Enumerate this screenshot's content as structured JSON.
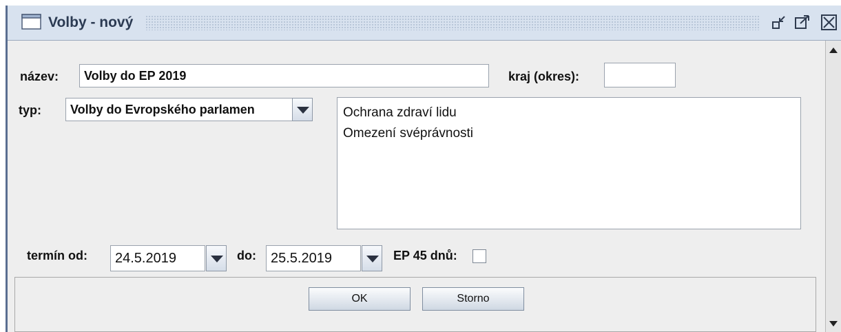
{
  "window": {
    "title": "Volby - nový",
    "buttons": [
      "iconify-icon",
      "maximize-icon",
      "close-icon"
    ]
  },
  "form": {
    "nazev_label": "název:",
    "nazev_value": "Volby do EP 2019",
    "kraj_label": "kraj (okres):",
    "kraj_value": "",
    "typ_label": "typ:",
    "typ_value": "Volby do Evropského parlamen",
    "list_items": [
      "Ochrana zdraví lidu",
      "Omezení svéprávnosti"
    ],
    "termin_od_label": "termín od:",
    "termin_od_value": "24.5.2019",
    "do_label": "do:",
    "do_value": "25.5.2019",
    "ep45_label": "EP 45 dnů:",
    "ep45_checked": false
  },
  "buttons": {
    "ok_label": "OK",
    "storno_label": "Storno"
  }
}
